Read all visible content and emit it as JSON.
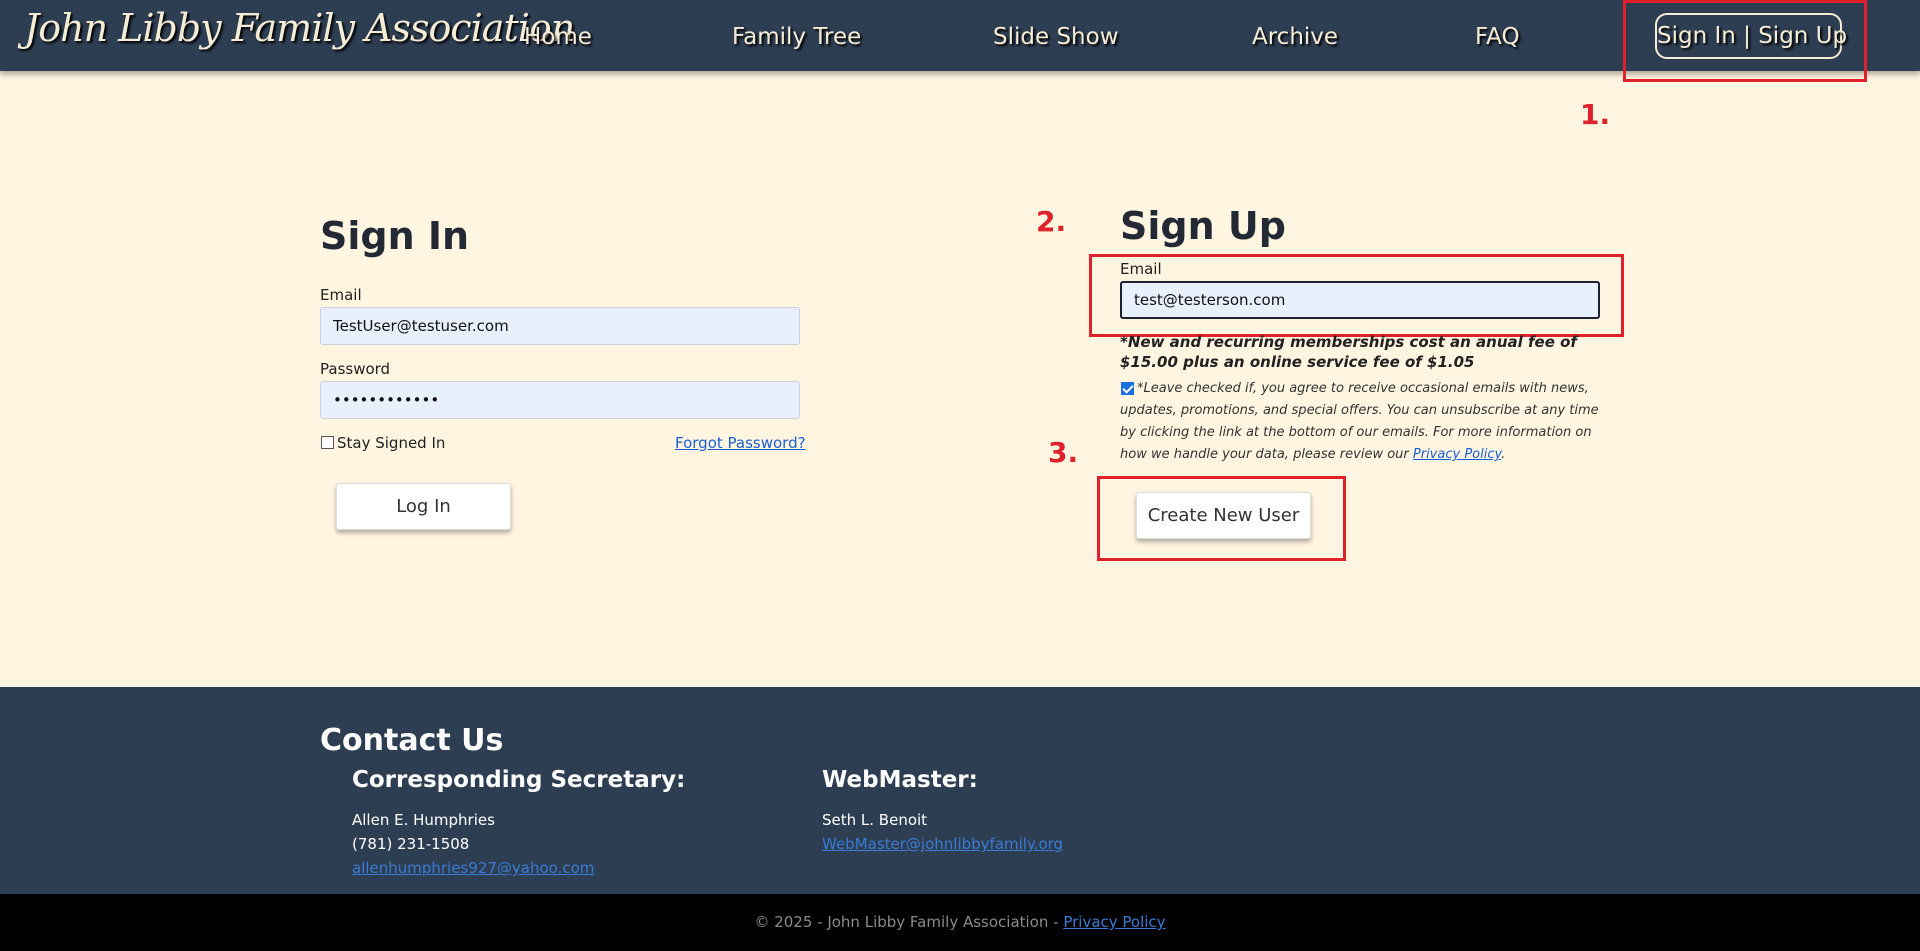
{
  "nav": {
    "brand": "John Libby Family Association",
    "links": [
      "Home",
      "Family Tree",
      "Slide Show",
      "Archive",
      "FAQ"
    ],
    "signin_label": "Sign In | Sign Up"
  },
  "annotations": [
    "1.",
    "2.",
    "3."
  ],
  "signin": {
    "title": "Sign In",
    "email_label": "Email",
    "email_value": "TestUser@testuser.com",
    "password_label": "Password",
    "password_value": "••••••••••••",
    "stay_signed_in": "Stay Signed In",
    "forgot_password": "Forgot Password?",
    "login_button": "Log In"
  },
  "signup": {
    "title": "Sign Up",
    "email_label": "Email",
    "email_value": "test@testerson.com",
    "fee_note": "*New and recurring memberships cost an anual fee of $15.00 plus an online service fee of $1.05",
    "consent_text": "*Leave checked if, you agree to receive occasional emails with news, updates, promotions, and special offers. You can unsubscribe at any time by clicking the link at the bottom of our emails. For more information on how we handle your data, please review our ",
    "privacy_link": "Privacy Policy",
    "consent_end": ".",
    "create_button": "Create New User"
  },
  "footer": {
    "contact_title": "Contact Us",
    "secretary": {
      "title": "Corresponding Secretary:",
      "name": "Allen E. Humphries",
      "phone": "(781) 231-1508",
      "email": "allenhumphries927@yahoo.com"
    },
    "webmaster": {
      "title": "WebMaster:",
      "name": "Seth L. Benoit",
      "email": "WebMaster@johnlibbyfamily.org"
    },
    "copyright": "© 2025 - John Libby Family Association - ",
    "privacy_link": "Privacy Policy"
  },
  "colors": {
    "nav_bg": "#2e3e52",
    "page_bg": "#fff5e0",
    "annotation": "#e0202a",
    "link": "#1a5fd6"
  }
}
